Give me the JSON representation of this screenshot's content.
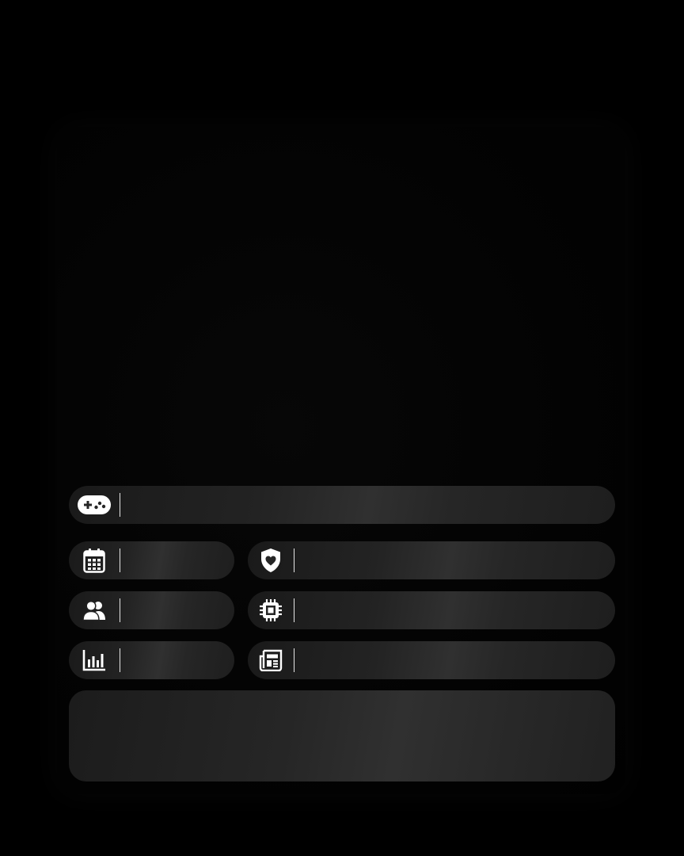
{
  "menu": {
    "games": {
      "icon": "gamepad-icon",
      "label": ""
    },
    "calendar": {
      "icon": "calendar-icon",
      "label": ""
    },
    "health": {
      "icon": "shield-heart-icon",
      "label": ""
    },
    "people": {
      "icon": "users-icon",
      "label": ""
    },
    "tech": {
      "icon": "cpu-chip-icon",
      "label": ""
    },
    "stats": {
      "icon": "bar-chart-icon",
      "label": ""
    },
    "news": {
      "icon": "newspaper-icon",
      "label": ""
    }
  },
  "panel": {
    "text": ""
  }
}
